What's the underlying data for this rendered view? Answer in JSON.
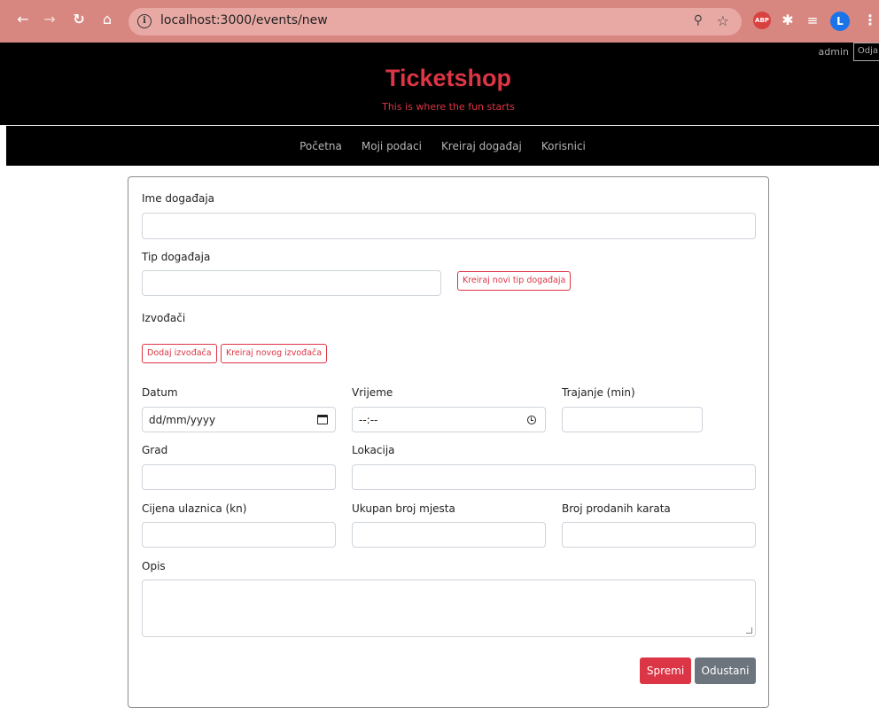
{
  "browser": {
    "url": "localhost:3000/events/new",
    "profile_initial": "L",
    "abp_label": "ABP"
  },
  "header": {
    "user": "admin",
    "logout_label": "Odja",
    "brand": "Ticketshop",
    "slogan": "This is where the fun starts",
    "brand_color": "#dc3545"
  },
  "nav": {
    "items": [
      {
        "label": "Početna"
      },
      {
        "label": "Moji podaci"
      },
      {
        "label": "Kreiraj događaj"
      },
      {
        "label": "Korisnici"
      }
    ]
  },
  "form": {
    "name_label": "Ime događaja",
    "type_label": "Tip događaja",
    "create_type_label": "Kreiraj novi tip događaja",
    "performers_label": "Izvođači",
    "add_performer_label": "Dodaj izvođača",
    "create_performer_label": "Kreiraj novog izvođača",
    "date_label": "Datum",
    "date_placeholder": "dd/mm/yyyy",
    "time_label": "Vrijeme",
    "time_placeholder": "--:--",
    "duration_label": "Trajanje (min)",
    "city_label": "Grad",
    "location_label": "Lokacija",
    "price_label": "Cijena ulaznica (kn)",
    "total_seats_label": "Ukupan broj mjesta",
    "sold_tickets_label": "Broj prodanih karata",
    "description_label": "Opis",
    "save_label": "Spremi",
    "cancel_label": "Odustani"
  }
}
